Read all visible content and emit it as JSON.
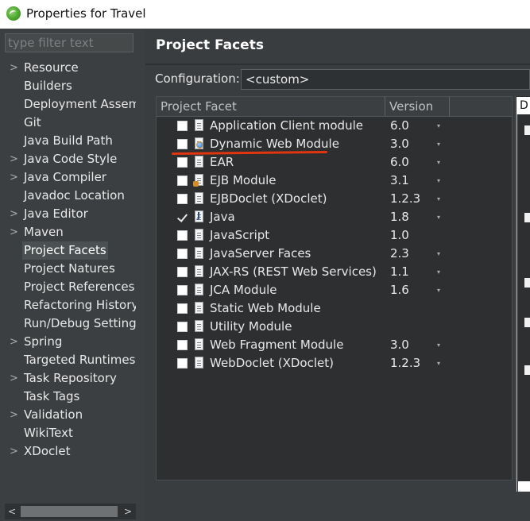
{
  "window": {
    "title": "Properties for Travel"
  },
  "filter": {
    "placeholder": "type filter text"
  },
  "sidebar": {
    "items": [
      {
        "label": "Resource",
        "expandable": true
      },
      {
        "label": "Builders",
        "expandable": false
      },
      {
        "label": "Deployment Assemb",
        "expandable": false
      },
      {
        "label": "Git",
        "expandable": false
      },
      {
        "label": "Java Build Path",
        "expandable": false
      },
      {
        "label": "Java Code Style",
        "expandable": true
      },
      {
        "label": "Java Compiler",
        "expandable": true
      },
      {
        "label": "Javadoc Location",
        "expandable": false
      },
      {
        "label": "Java Editor",
        "expandable": true
      },
      {
        "label": "Maven",
        "expandable": true
      },
      {
        "label": "Project Facets",
        "expandable": false,
        "selected": true
      },
      {
        "label": "Project Natures",
        "expandable": false
      },
      {
        "label": "Project References",
        "expandable": false
      },
      {
        "label": "Refactoring History",
        "expandable": false
      },
      {
        "label": "Run/Debug Settings",
        "expandable": false
      },
      {
        "label": "Spring",
        "expandable": true
      },
      {
        "label": "Targeted Runtimes",
        "expandable": false
      },
      {
        "label": "Task Repository",
        "expandable": true
      },
      {
        "label": "Task Tags",
        "expandable": false
      },
      {
        "label": "Validation",
        "expandable": true
      },
      {
        "label": "WikiText",
        "expandable": false
      },
      {
        "label": "XDoclet",
        "expandable": true
      }
    ],
    "scroll_left": "<",
    "scroll_right": ">"
  },
  "page": {
    "title": "Project Facets"
  },
  "configuration": {
    "label": "Configuration:",
    "value": "<custom>"
  },
  "table": {
    "col_facet": "Project Facet",
    "col_version": "Version",
    "rows": [
      {
        "name": "Application Client module",
        "version": "6.0",
        "checked": false,
        "icon": "doc-icon",
        "has_dropdown": true
      },
      {
        "name": "Dynamic Web Module",
        "version": "3.0",
        "checked": false,
        "icon": "web-module-icon",
        "has_dropdown": true
      },
      {
        "name": "EAR",
        "version": "6.0",
        "checked": false,
        "icon": "doc-icon",
        "has_dropdown": true
      },
      {
        "name": "EJB Module",
        "version": "3.1",
        "checked": false,
        "icon": "ejb-icon",
        "has_dropdown": true
      },
      {
        "name": "EJBDoclet (XDoclet)",
        "version": "1.2.3",
        "checked": false,
        "icon": "doc-icon",
        "has_dropdown": true
      },
      {
        "name": "Java",
        "version": "1.8",
        "checked": true,
        "icon": "java-icon",
        "has_dropdown": true
      },
      {
        "name": "JavaScript",
        "version": "1.0",
        "checked": false,
        "icon": "doc-icon",
        "has_dropdown": false
      },
      {
        "name": "JavaServer Faces",
        "version": "2.3",
        "checked": false,
        "icon": "doc-icon",
        "has_dropdown": true
      },
      {
        "name": "JAX-RS (REST Web Services)",
        "version": "1.1",
        "checked": false,
        "icon": "doc-icon",
        "has_dropdown": true
      },
      {
        "name": "JCA Module",
        "version": "1.6",
        "checked": false,
        "icon": "doc-icon",
        "has_dropdown": true
      },
      {
        "name": "Static Web Module",
        "version": "",
        "checked": false,
        "icon": "doc-icon",
        "has_dropdown": false
      },
      {
        "name": "Utility Module",
        "version": "",
        "checked": false,
        "icon": "doc-icon",
        "has_dropdown": false
      },
      {
        "name": "Web Fragment Module",
        "version": "3.0",
        "checked": false,
        "icon": "doc-icon",
        "has_dropdown": true
      },
      {
        "name": "WebDoclet (XDoclet)",
        "version": "1.2.3",
        "checked": false,
        "icon": "doc-icon",
        "has_dropdown": true
      }
    ],
    "dropdown_glyph": "▾"
  },
  "details": {
    "tab_label": "D"
  },
  "colors": {
    "panel_bg": "#3c3f41",
    "table_bg": "#2d2f31",
    "text": "#e8e8e8",
    "annotation_underline": "#e1350f"
  }
}
